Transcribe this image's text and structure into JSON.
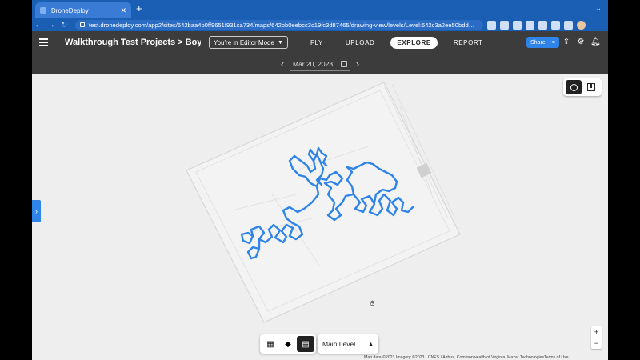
{
  "browser": {
    "tab_title": "DroneDeploy",
    "tab_close": "✕",
    "new_tab": "+",
    "tabs_menu": "⌄",
    "url": "test.dronedeploy.com/app2/sites/642baa4b0ff9651f931ca734/maps/642bb0eebcc3c19fc3d87465/drawing-view/levels/Level:642c3a2ee50bdd…",
    "back": "←",
    "forward": "→",
    "reload": "↻"
  },
  "header": {
    "project_title": "Walkthrough Test Projects > Boys and …",
    "mode_label": "You're in Editor Mode",
    "tabs": [
      {
        "label": "FLY"
      },
      {
        "label": "UPLOAD"
      },
      {
        "label": "EXPLORE"
      },
      {
        "label": "REPORT"
      }
    ],
    "active_tab": "EXPLORE",
    "share_label": "Share"
  },
  "datebar": {
    "date": "Mar 20, 2023",
    "prev": "‹",
    "next": "›"
  },
  "map": {
    "path_color": "#2e84e8",
    "level_label": "Main Level",
    "zoom_in": "+",
    "zoom_out": "−",
    "attribution": "Map data ©2023 Imagery ©2023 , CNES / Airbus, Commonwealth of Virginia, Maxar Technologies",
    "terms": "Terms of Use",
    "side_tab": "›"
  }
}
